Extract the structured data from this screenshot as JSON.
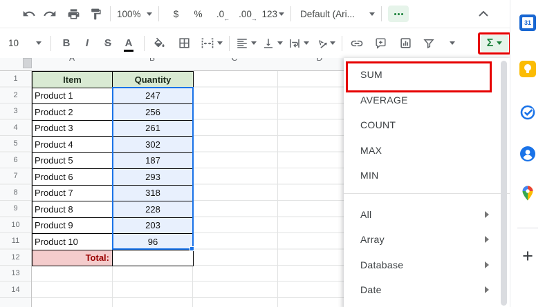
{
  "toolbar": {
    "zoom_level": "100%",
    "currency_label": "$",
    "percent_label": "%",
    "decrease_decimal_label": ".0",
    "decrease_decimal_arrow": "←",
    "increase_decimal_label": ".00",
    "increase_decimal_arrow": "→",
    "more_formats_label": "123",
    "font_name": "Default (Ari...",
    "font_size": "10",
    "bold_label": "B",
    "italic_label": "I",
    "strikethrough_label": "S",
    "text_color_label": "A",
    "functions_label": "Σ"
  },
  "menu": {
    "function_items": [
      "SUM",
      "AVERAGE",
      "COUNT",
      "MAX",
      "MIN"
    ],
    "category_items": [
      "All",
      "Array",
      "Database",
      "Date"
    ],
    "highlighted_item": "SUM"
  },
  "sheet": {
    "column_letters": [
      "A",
      "B",
      "C",
      "D"
    ],
    "row_count": 14,
    "table": {
      "headers": [
        "Item",
        "Quantity"
      ],
      "rows": [
        [
          "Product 1",
          "247"
        ],
        [
          "Product 2",
          "256"
        ],
        [
          "Product 3",
          "261"
        ],
        [
          "Product 4",
          "302"
        ],
        [
          "Product 5",
          "187"
        ],
        [
          "Product 6",
          "293"
        ],
        [
          "Product 7",
          "318"
        ],
        [
          "Product 8",
          "228"
        ],
        [
          "Product 9",
          "203"
        ],
        [
          "Product 10",
          "96"
        ]
      ],
      "total_label": "Total:",
      "total_value": ""
    },
    "selection_range": "B2:B11"
  },
  "sidebar": {
    "calendar_label": "31",
    "addons_label": "+",
    "icons": [
      "google-calendar",
      "google-keep",
      "google-tasks",
      "google-contacts",
      "google-maps",
      "get-addons"
    ]
  },
  "colors": {
    "accent_green": "#188038",
    "button_green_bg": "#e6f4ea",
    "highlight_red": "#e60000",
    "selection_blue": "#1a73e8",
    "selection_fill": "#e8f0fd",
    "header_green": "#d9ead3",
    "total_pink": "#f4cccc",
    "total_text": "#990000"
  }
}
